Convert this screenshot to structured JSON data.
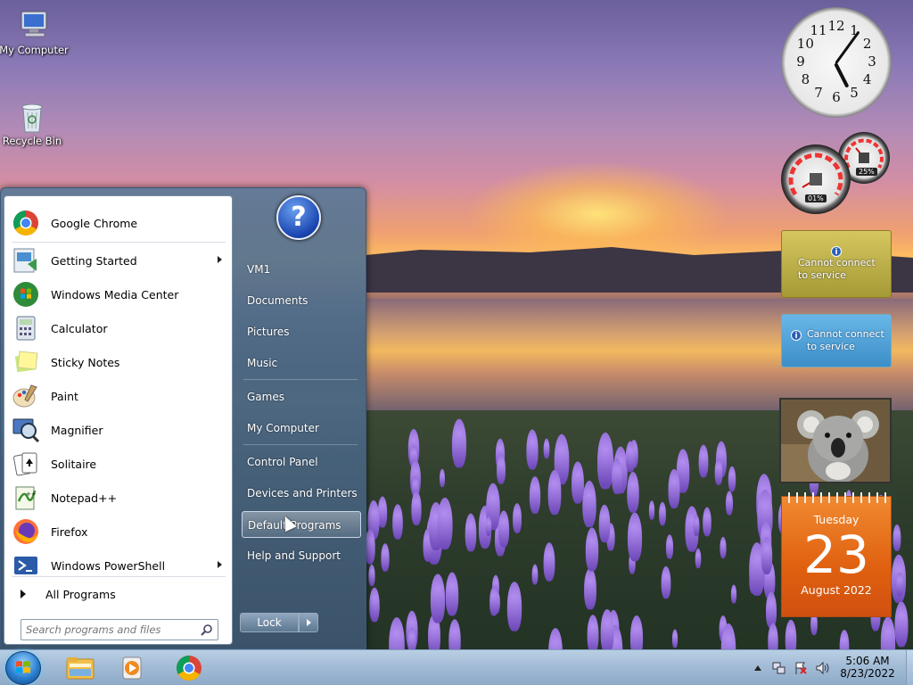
{
  "desktop": {
    "icons": [
      {
        "label": "My Computer"
      },
      {
        "label": "Recycle Bin"
      }
    ]
  },
  "gadgets": {
    "clock": {
      "numbers": [
        "12",
        "1",
        "2",
        "3",
        "4",
        "5",
        "6",
        "7",
        "8",
        "9",
        "10",
        "11"
      ],
      "time": "5:06"
    },
    "cpu_meter": {
      "cpu": "01%",
      "memory": "25%"
    },
    "weather": {
      "message_line1": "Cannot connect",
      "message_line2": "to service",
      "icon": "info-icon"
    },
    "feed": {
      "message_line1": "Cannot connect",
      "message_line2": "to service",
      "icon": "info-icon"
    },
    "slideshow": {
      "subject": "koala"
    },
    "calendar": {
      "weekday": "Tuesday",
      "day": "23",
      "month_year": "August 2022"
    }
  },
  "start_menu": {
    "programs": [
      {
        "label": "Google Chrome",
        "icon": "chrome-icon",
        "submenu": false
      },
      {
        "label": "Getting Started",
        "icon": "getting-started-icon",
        "submenu": true
      },
      {
        "label": "Windows Media Center",
        "icon": "media-center-icon",
        "submenu": false
      },
      {
        "label": "Calculator",
        "icon": "calculator-icon",
        "submenu": false
      },
      {
        "label": "Sticky Notes",
        "icon": "sticky-notes-icon",
        "submenu": false
      },
      {
        "label": "Paint",
        "icon": "paint-icon",
        "submenu": false
      },
      {
        "label": "Magnifier",
        "icon": "magnifier-icon",
        "submenu": false
      },
      {
        "label": "Solitaire",
        "icon": "solitaire-icon",
        "submenu": false
      },
      {
        "label": "Notepad++",
        "icon": "notepad-plus-icon",
        "submenu": false
      },
      {
        "label": "Firefox",
        "icon": "firefox-icon",
        "submenu": false
      },
      {
        "label": "Windows PowerShell",
        "icon": "powershell-icon",
        "submenu": true
      }
    ],
    "all_programs": "All Programs",
    "search_placeholder": "Search programs and files",
    "right_items": [
      {
        "label": "VM1",
        "key": "vm1"
      },
      {
        "label": "Documents",
        "key": "documents"
      },
      {
        "label": "Pictures",
        "key": "pictures"
      },
      {
        "label": "Music",
        "key": "music"
      },
      {
        "label": "Games",
        "key": "games"
      },
      {
        "label": "My Computer",
        "key": "my-computer"
      },
      {
        "label": "Control Panel",
        "key": "control-panel"
      },
      {
        "label": "Devices and Printers",
        "key": "devices-and-printers"
      },
      {
        "label": "Default Programs",
        "key": "default-programs",
        "highlighted": true
      },
      {
        "label": "Help and Support",
        "key": "help-and-support"
      }
    ],
    "help_glyph": "?",
    "lock_label": "Lock"
  },
  "taskbar": {
    "pinned": [
      {
        "name": "explorer-icon"
      },
      {
        "name": "media-player-icon"
      },
      {
        "name": "chrome-icon"
      }
    ],
    "time": "5:06 AM",
    "date": "8/23/2022"
  }
}
